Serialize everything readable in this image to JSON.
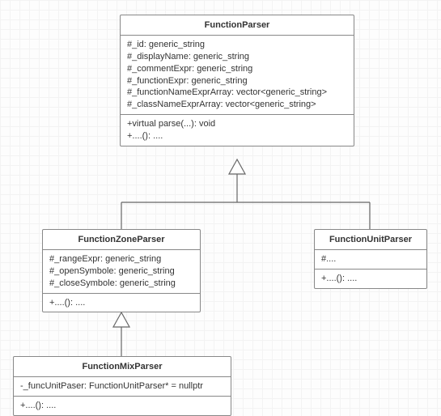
{
  "functionParser": {
    "title": "FunctionParser",
    "attrs": "#_id: generic_string\n#_displayName: generic_string\n#_commentExpr: generic_string\n#_functionExpr: generic_string\n#_functionNameExprArray: vector<generic_string>\n#_classNameExprArray: vector<generic_string>",
    "ops": "+virtual parse(...): void\n+....(): ...."
  },
  "functionZoneParser": {
    "title": "FunctionZoneParser",
    "attrs": "#_rangeExpr: generic_string\n#_openSymbole: generic_string\n#_closeSymbole: generic_string",
    "ops": "+....(): ...."
  },
  "functionUnitParser": {
    "title": "FunctionUnitParser",
    "attrs": "#....",
    "ops": "+....(): ...."
  },
  "functionMixParser": {
    "title": "FunctionMixParser",
    "attrs": "-_funcUnitPaser: FunctionUnitParser* = nullptr",
    "ops": "+....(): ...."
  }
}
